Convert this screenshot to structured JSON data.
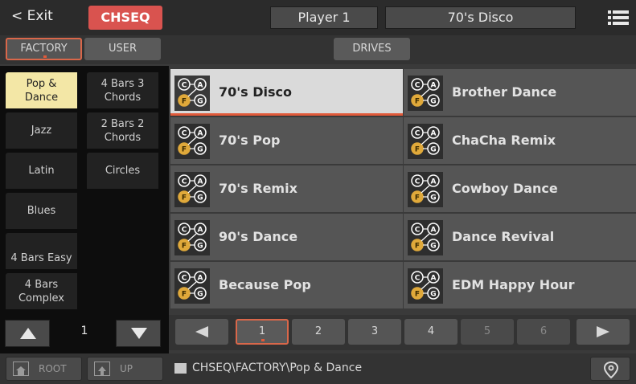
{
  "topbar": {
    "exit_label": "< Exit",
    "mode_label": "CHSEQ",
    "player_label": "Player 1",
    "style_label": "70's Disco"
  },
  "tabs": {
    "factory": "FACTORY",
    "user": "USER",
    "drives": "DRIVES"
  },
  "folders": [
    {
      "label_line1": "Pop &",
      "label_line2": "Dance",
      "selected": true
    },
    {
      "label_line1": "4 Bars 3",
      "label_line2": "Chords",
      "selected": false
    },
    {
      "label_line1": "Jazz",
      "label_line2": "",
      "selected": false
    },
    {
      "label_line1": "2 Bars 2",
      "label_line2": "Chords",
      "selected": false
    },
    {
      "label_line1": "Latin",
      "label_line2": "",
      "selected": false
    },
    {
      "label_line1": "Circles",
      "label_line2": "",
      "selected": false
    },
    {
      "label_line1": "Blues",
      "label_line2": "",
      "selected": false
    },
    {
      "label_line1": "4 Bars Easy",
      "label_line2": "",
      "selected": false
    },
    {
      "label_line1": "4 Bars",
      "label_line2": "Complex",
      "selected": false
    }
  ],
  "folder_page": "1",
  "items": [
    {
      "name": "70's Disco",
      "selected": true
    },
    {
      "name": "Brother Dance",
      "selected": false
    },
    {
      "name": "70's Pop",
      "selected": false
    },
    {
      "name": "ChaCha Remix",
      "selected": false
    },
    {
      "name": "70's Remix",
      "selected": false
    },
    {
      "name": "Cowboy Dance",
      "selected": false
    },
    {
      "name": "90's Dance",
      "selected": false
    },
    {
      "name": "Dance Revival",
      "selected": false
    },
    {
      "name": "Because Pop",
      "selected": false
    },
    {
      "name": "EDM Happy Hour",
      "selected": false
    }
  ],
  "chord_icon_letters": [
    "C",
    "A",
    "F",
    "G"
  ],
  "pages": [
    "1",
    "2",
    "3",
    "4",
    "5",
    "6"
  ],
  "current_page": "1",
  "statusbar": {
    "root_label": "ROOT",
    "up_label": "UP",
    "path": "CHSEQ\\FACTORY\\Pop & Dance"
  },
  "colors": {
    "accent": "#d9534f",
    "highlight_border": "#e05a3a",
    "selected_folder": "#f3e7a6",
    "icon_gold": "#e0a93a"
  }
}
